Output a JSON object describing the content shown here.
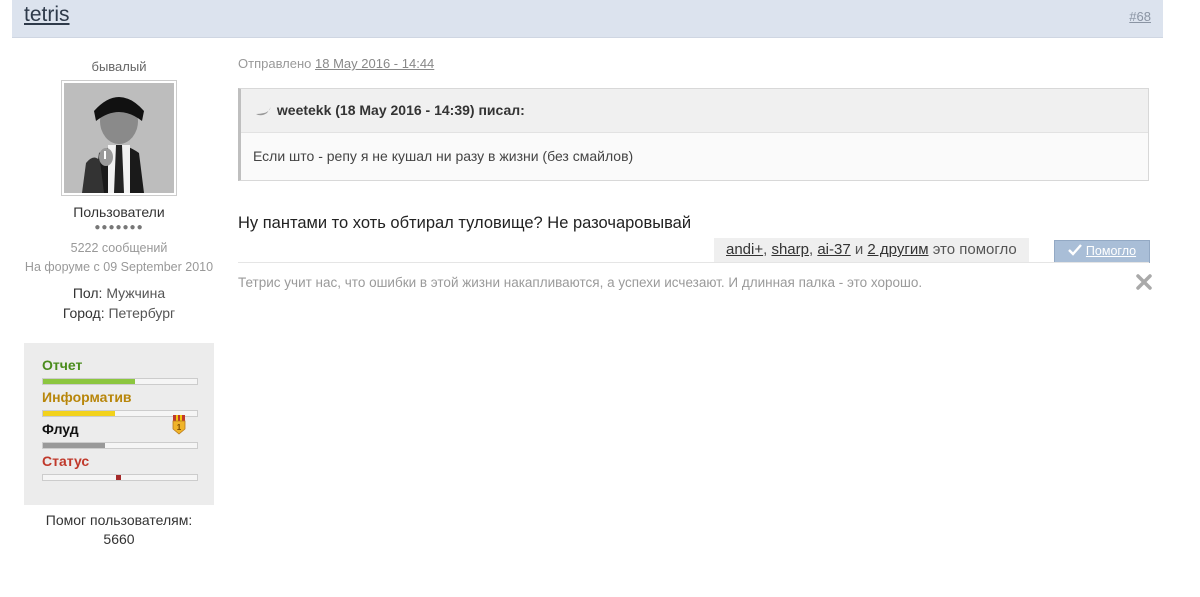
{
  "post": {
    "author": "tetris",
    "number": "#68"
  },
  "author_info": {
    "rank": "бывалый",
    "group": "Пользователи",
    "pips": "●●●●●●●",
    "messages": "5222 сообщений",
    "member_since": "На форуме с 09 September 2010",
    "gender_label": "Пол:",
    "gender_value": "Мужчина",
    "city_label": "Город:",
    "city_value": "Петербург",
    "help_label": "Помог пользователям:",
    "help_value": "5660"
  },
  "reputation": [
    {
      "label": "Отчет",
      "color": "#4a8c1c",
      "fill_color": "#8cc63f",
      "fill": 0.6
    },
    {
      "label": "Информатив",
      "color": "#b8860b",
      "fill_color": "#f2d21c",
      "fill": 0.47
    },
    {
      "label": "Флуд",
      "color": "#111111",
      "fill_color": "#999999",
      "fill": 0.4,
      "medal": "1"
    },
    {
      "label": "Статус",
      "color": "#c0392b",
      "fill_color": "#a52a2a",
      "fill": 0.03
    }
  ],
  "content": {
    "posted_prefix": "Отправлено",
    "posted_date": "18 May 2016 - 14:44",
    "quote_header": "weetekk (18 May 2016 - 14:39) писал:",
    "quote_text": "Если што - репу я не кушал ни разу в жизни (без смайлов)",
    "message": "Ну пантами то хоть обтирал туловище? Не разочаровывай",
    "likes": {
      "user1": "andi+",
      "sep1": ", ",
      "user2": "sharp",
      "sep2": ", ",
      "user3": "ai-37",
      "and": " и ",
      "others": "2 другим",
      "suffix": " это помогло"
    },
    "helped_button": "Помогло",
    "signature": "Тетрис учит нас, что ошибки в этой жизни накапливаются, а успехи исчезают. И длинная палка - это хорошо."
  }
}
